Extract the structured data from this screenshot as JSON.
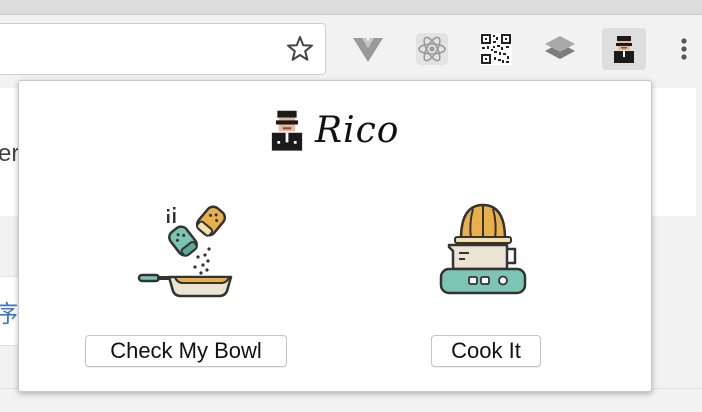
{
  "popup": {
    "brand_title": "Rico",
    "actions": [
      {
        "label": "Check My Bowl",
        "icon": "seasoning-pan-icon"
      },
      {
        "label": "Cook It",
        "icon": "juicer-icon"
      }
    ]
  },
  "toolbar": {
    "extensions": [
      "vue-devtools-icon",
      "react-devtools-icon",
      "qr-code-icon",
      "layers-icon",
      "rico-avatar-icon"
    ],
    "active_extension": "rico-avatar-icon"
  },
  "page": {
    "partial_text_1": "er",
    "partial_text_2": "序"
  },
  "colors": {
    "teal": "#7cc4b4",
    "orange": "#e7b04a",
    "outline": "#333333",
    "link_blue": "#3a77c8"
  }
}
